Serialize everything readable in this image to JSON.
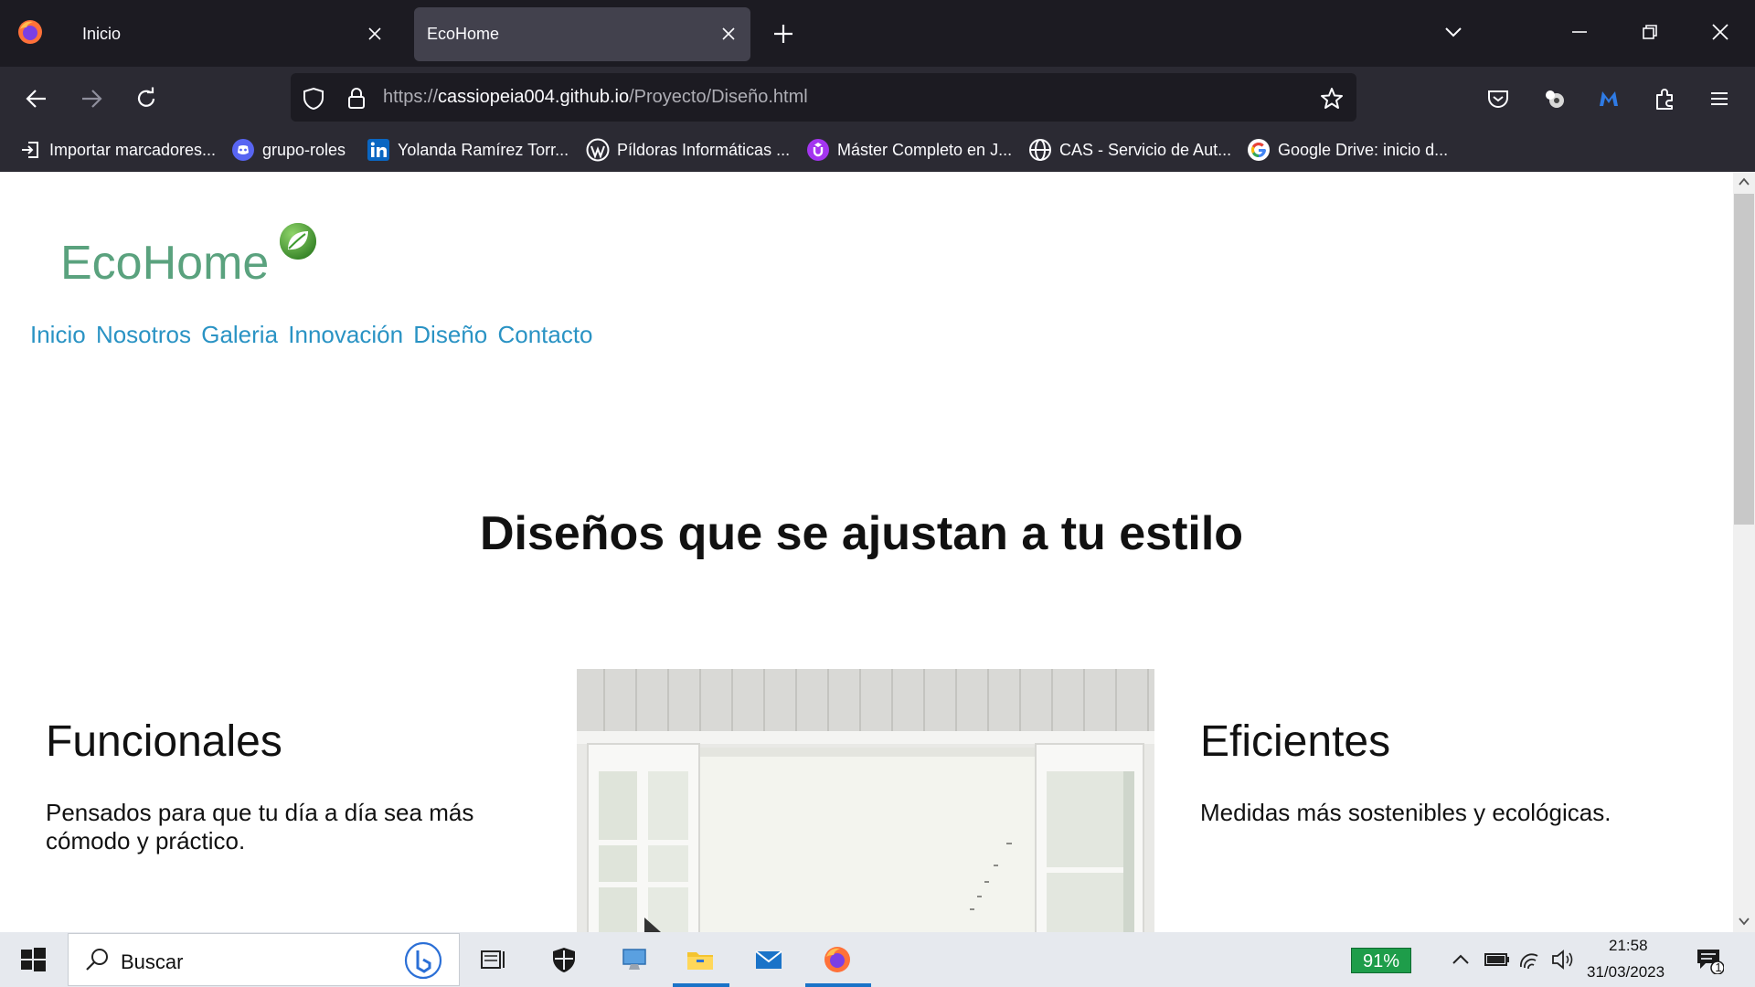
{
  "browser": {
    "tabs": [
      {
        "label": "Inicio",
        "active": false
      },
      {
        "label": "EcoHome",
        "active": true
      }
    ],
    "url": {
      "scheme": "https://",
      "host": "cassiopeia004.github.io",
      "path": "/Proyecto/Diseño.html"
    },
    "bookmarks": [
      {
        "label": "Importar marcadores...",
        "icon": "import-icon"
      },
      {
        "label": "grupo-roles",
        "icon": "discord-icon"
      },
      {
        "label": "Yolanda Ramírez Torr...",
        "icon": "linkedin-icon"
      },
      {
        "label": "Píldoras Informáticas ...",
        "icon": "wordpress-icon"
      },
      {
        "label": "Máster Completo en J...",
        "icon": "udemy-icon"
      },
      {
        "label": "CAS - Servicio de Aut...",
        "icon": "globe-icon"
      },
      {
        "label": "Google Drive: inicio d...",
        "icon": "google-icon"
      }
    ]
  },
  "page": {
    "brand": "EcoHome",
    "nav": [
      "Inicio",
      "Nosotros",
      "Galeria",
      "Innovación",
      "Diseño",
      "Contacto"
    ],
    "headline": "Diseños que se ajustan a tu estilo",
    "left_column": {
      "title": "Funcionales",
      "text": "Pensados para que tu día a día sea más cómodo y práctico."
    },
    "right_column": {
      "title": "Eficientes",
      "text": "Medidas más sostenibles y ecológicas."
    }
  },
  "taskbar": {
    "search_placeholder": "Buscar",
    "battery": "91%",
    "time": "21:58",
    "date": "31/03/2023",
    "notifications": "1"
  },
  "colors": {
    "brand_green": "#5aa27e",
    "nav_blue": "#2a93c4",
    "tabbar_bg": "#1c1b22",
    "toolbar_bg": "#2b2a33"
  }
}
